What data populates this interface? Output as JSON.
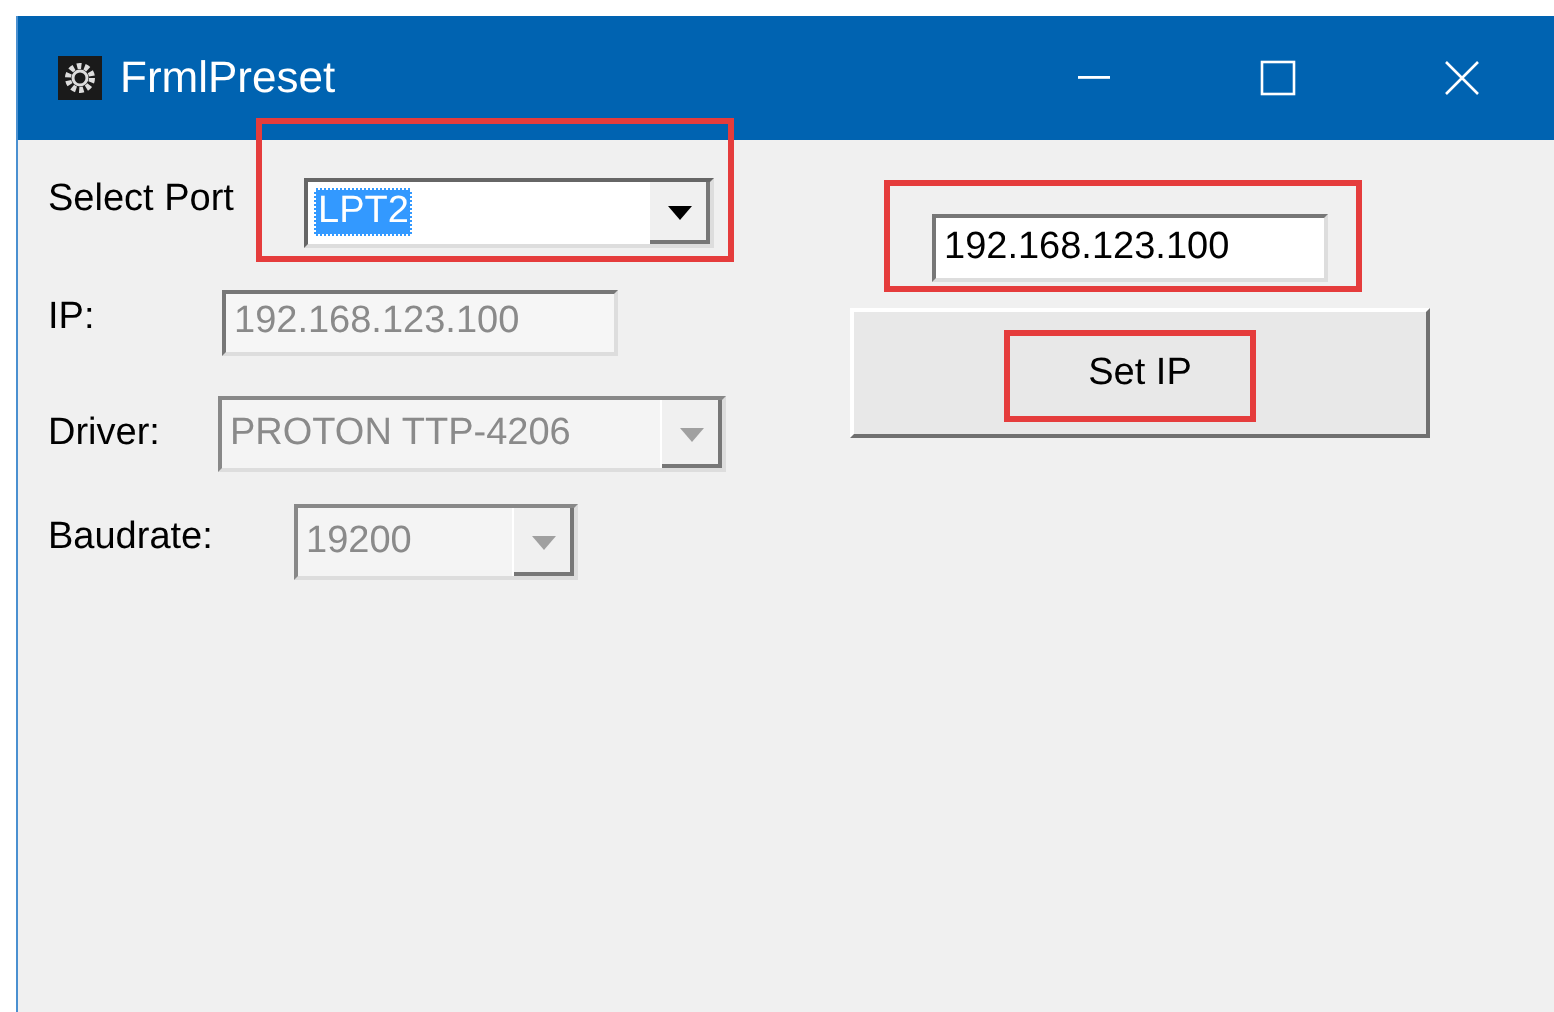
{
  "window": {
    "title": "FrmlPreset"
  },
  "fields": [
    {
      "kind": "combo",
      "label": "Select Port",
      "value": "LPT2",
      "disabled": false,
      "text_selected": true,
      "highlighted": true
    },
    {
      "kind": "text",
      "label": "IP:",
      "value": "192.168.123.100",
      "disabled": true,
      "highlighted": false
    },
    {
      "kind": "combo",
      "label": "Driver:",
      "value": "PROTON TTP-4206",
      "disabled": true,
      "text_selected": false,
      "highlighted": false
    },
    {
      "kind": "combo",
      "label": "Baudrate:",
      "value": "19200",
      "disabled": true,
      "text_selected": false,
      "highlighted": false
    }
  ],
  "ip_input": {
    "value": "192.168.123.100",
    "highlighted": true
  },
  "set_ip_button": {
    "label": "Set IP",
    "highlighted": true
  }
}
